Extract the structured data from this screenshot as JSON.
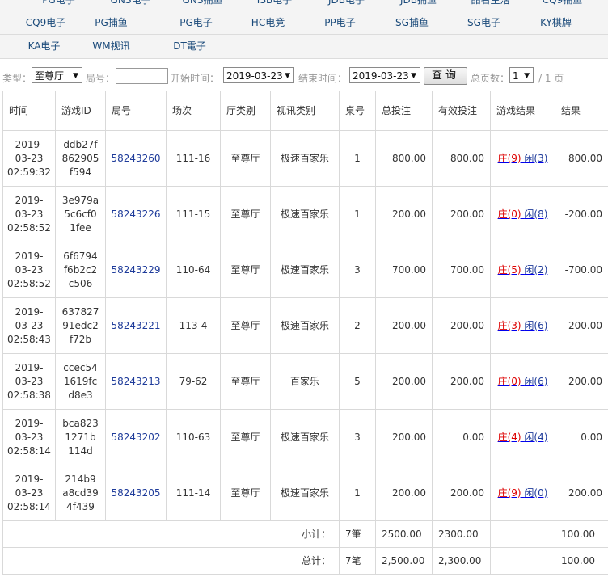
{
  "tabs": [
    [
      "PG电子",
      "GNS电子",
      "GNS捕鱼",
      "ISB电子",
      "JDB电子",
      "JDB捕鱼",
      "品名生活",
      "CQ9捕鱼"
    ],
    [
      "CQ9电子",
      "PG捕鱼",
      "PG电子",
      "HC电竞",
      "PP电子",
      "SG捕鱼",
      "SG电子",
      "KY棋牌"
    ],
    [
      "KA电子",
      "WM视讯",
      "DT電子"
    ]
  ],
  "filter": {
    "type_label": "类型：",
    "type_value": "至尊厅",
    "round_label": "局号：",
    "start_label": "开始时间：",
    "start_value": "2019-03-23",
    "end_label": "结束时间：",
    "end_value": "2019-03-23",
    "query_button": "查询",
    "pages_label": "总页数：",
    "page_value": "1",
    "pages_total": "/ 1 页"
  },
  "headers": [
    "时间",
    "游戏ID",
    "局号",
    "场次",
    "厅类别",
    "视讯类别",
    "桌号",
    "总投注",
    "有效投注",
    "游戏结果",
    "结果"
  ],
  "rows": [
    {
      "date": "2019-",
      "date2": "03-23",
      "time": "02:59:32",
      "id1": "ddb27f",
      "id2": "862905",
      "id3": "f594",
      "round": "58243260",
      "session": "111-16",
      "hall": "至尊厅",
      "cat": "极速百家乐",
      "table": "1",
      "bet": "800.00",
      "valid": "800.00",
      "banker": "庄(9)",
      "player": "闲(3)",
      "result": "800.00"
    },
    {
      "date": "2019-",
      "date2": "03-23",
      "time": "02:58:52",
      "id1": "3e979a",
      "id2": "5c6cf0",
      "id3": "1fee",
      "round": "58243226",
      "session": "111-15",
      "hall": "至尊厅",
      "cat": "极速百家乐",
      "table": "1",
      "bet": "200.00",
      "valid": "200.00",
      "banker": "庄(0)",
      "player": "闲(8)",
      "result": "-200.00"
    },
    {
      "date": "2019-",
      "date2": "03-23",
      "time": "02:58:52",
      "id1": "6f6794",
      "id2": "f6b2c2",
      "id3": "c506",
      "round": "58243229",
      "session": "110-64",
      "hall": "至尊厅",
      "cat": "极速百家乐",
      "table": "3",
      "bet": "700.00",
      "valid": "700.00",
      "banker": "庄(5)",
      "player": "闲(2)",
      "result": "-700.00"
    },
    {
      "date": "2019-",
      "date2": "03-23",
      "time": "02:58:43",
      "id1": "637827",
      "id2": "91edc2",
      "id3": "f72b",
      "round": "58243221",
      "session": "113-4",
      "hall": "至尊厅",
      "cat": "极速百家乐",
      "table": "2",
      "bet": "200.00",
      "valid": "200.00",
      "banker": "庄(3)",
      "player": "闲(6)",
      "result": "-200.00"
    },
    {
      "date": "2019-",
      "date2": "03-23",
      "time": "02:58:38",
      "id1": "ccec54",
      "id2": "1619fc",
      "id3": "d8e3",
      "round": "58243213",
      "session": "79-62",
      "hall": "至尊厅",
      "cat": "百家乐",
      "table": "5",
      "bet": "200.00",
      "valid": "200.00",
      "banker": "庄(0)",
      "player": "闲(6)",
      "result": "200.00"
    },
    {
      "date": "2019-",
      "date2": "03-23",
      "time": "02:58:14",
      "id1": "bca823",
      "id2": "1271b",
      "id3": "114d",
      "round": "58243202",
      "session": "110-63",
      "hall": "至尊厅",
      "cat": "极速百家乐",
      "table": "3",
      "bet": "200.00",
      "valid": "0.00",
      "banker": "庄(4)",
      "player": "闲(4)",
      "result": "0.00"
    },
    {
      "date": "2019-",
      "date2": "03-23",
      "time": "02:58:14",
      "id1": "214b9",
      "id2": "a8cd39",
      "id3": "4f439",
      "round": "58243205",
      "session": "111-14",
      "hall": "至尊厅",
      "cat": "极速百家乐",
      "table": "1",
      "bet": "200.00",
      "valid": "200.00",
      "banker": "庄(9)",
      "player": "闲(0)",
      "result": "200.00"
    }
  ],
  "subtotal": {
    "label": "小计：",
    "count": "7筆",
    "bet": "2500.00",
    "valid": "2300.00",
    "result": "100.00"
  },
  "total": {
    "label": "总计：",
    "count": "7笔",
    "bet": "2,500.00",
    "valid": "2,300.00",
    "result": "100.00"
  }
}
